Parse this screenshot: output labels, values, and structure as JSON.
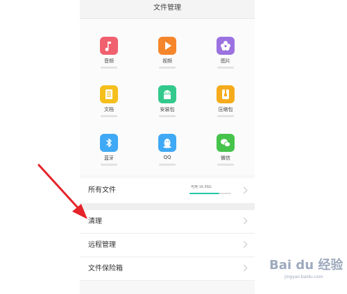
{
  "header": {
    "title": "文件管理"
  },
  "categories": [
    {
      "label": "音频",
      "icon": "music-note-icon",
      "color": "#f0606e"
    },
    {
      "label": "视频",
      "icon": "play-icon",
      "color": "#f6862b"
    },
    {
      "label": "图片",
      "icon": "flower-icon",
      "color": "#9b72e0"
    },
    {
      "label": "文档",
      "icon": "document-icon",
      "color": "#f5bf1c"
    },
    {
      "label": "安装包",
      "icon": "android-icon",
      "color": "#34c98c"
    },
    {
      "label": "压缩包",
      "icon": "archive-icon",
      "color": "#f5ab1c"
    },
    {
      "label": "蓝牙",
      "icon": "bluetooth-icon",
      "color": "#3fa9f5"
    },
    {
      "label": "QQ",
      "icon": "qq-icon",
      "color": "#3fa9f5"
    },
    {
      "label": "微信",
      "icon": "wechat-icon",
      "color": "#45c34a"
    }
  ],
  "all_files": {
    "label": "所有文件",
    "usage": "可用 16.56G",
    "usage_fraction": 0.72,
    "bar_color": "#26c6a6"
  },
  "menu": [
    {
      "label": "清理"
    },
    {
      "label": "远程管理"
    },
    {
      "label": "文件保险箱"
    }
  ],
  "annotation": {
    "color": "#e5232a"
  },
  "watermark": {
    "brand": "Bai du 经验",
    "url": "jingyan.baidu.com"
  }
}
